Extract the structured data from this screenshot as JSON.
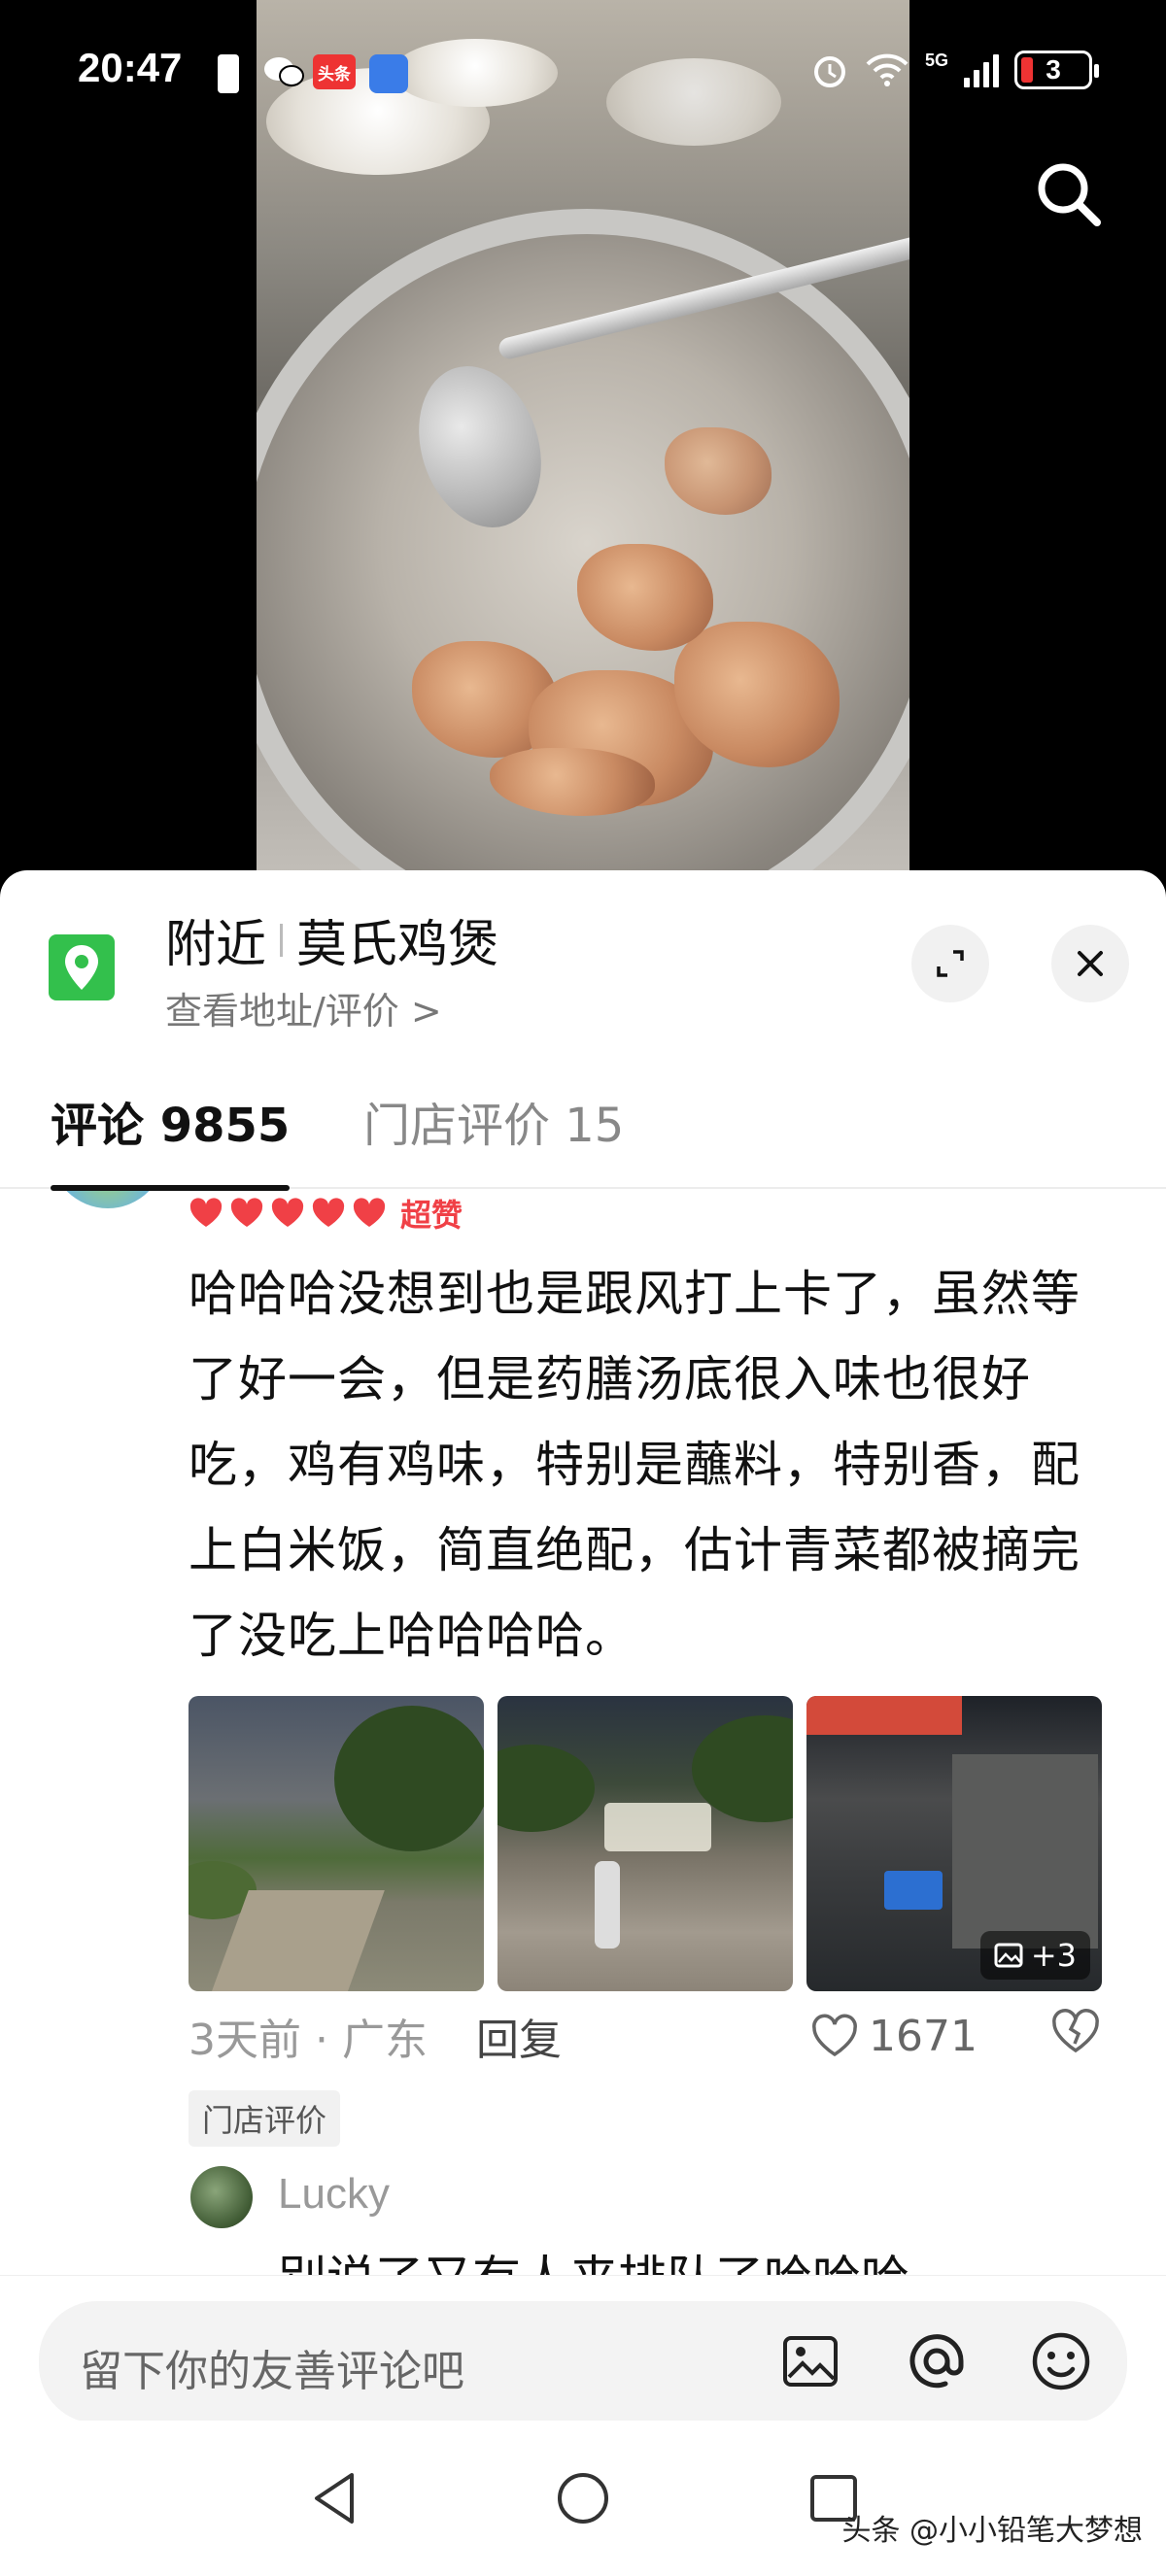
{
  "status_bar": {
    "time": "20:47",
    "network": "5G",
    "battery": "3",
    "app_badge": "头条"
  },
  "video": {
    "search_icon": "search-icon"
  },
  "location": {
    "prefix": "附近",
    "name": "莫氏鸡煲",
    "subtitle": "查看地址/评价 >",
    "pin_color": "#33C04C"
  },
  "tabs": [
    {
      "label": "评论 9855",
      "active": true
    },
    {
      "label": "门店评价 15",
      "active": false
    }
  ],
  "comment": {
    "rating_label": "超赞",
    "rating_hearts": 5,
    "text": "哈哈哈没想到也是跟风打上卡了，虽然等了好一会，但是药膳汤底很入味也很好吃，鸡有鸡味，特别是蘸料，特别香，配上白米饭，简直绝配，估计青菜都被摘完了没吃上哈哈哈哈。",
    "extra_photos": "+3",
    "time": "3天前 · 广东",
    "reply_label": "回复",
    "likes": "1671",
    "tag": "门店评价"
  },
  "reply": {
    "name": "Lucky",
    "text": "别说了又有人来排队了哈哈哈"
  },
  "input": {
    "placeholder": "留下你的友善评论吧"
  },
  "watermark": "头条 @小小铅笔大梦想",
  "colors": {
    "accent_red": "#F04046",
    "text_primary": "#111111",
    "text_secondary": "#999999"
  }
}
